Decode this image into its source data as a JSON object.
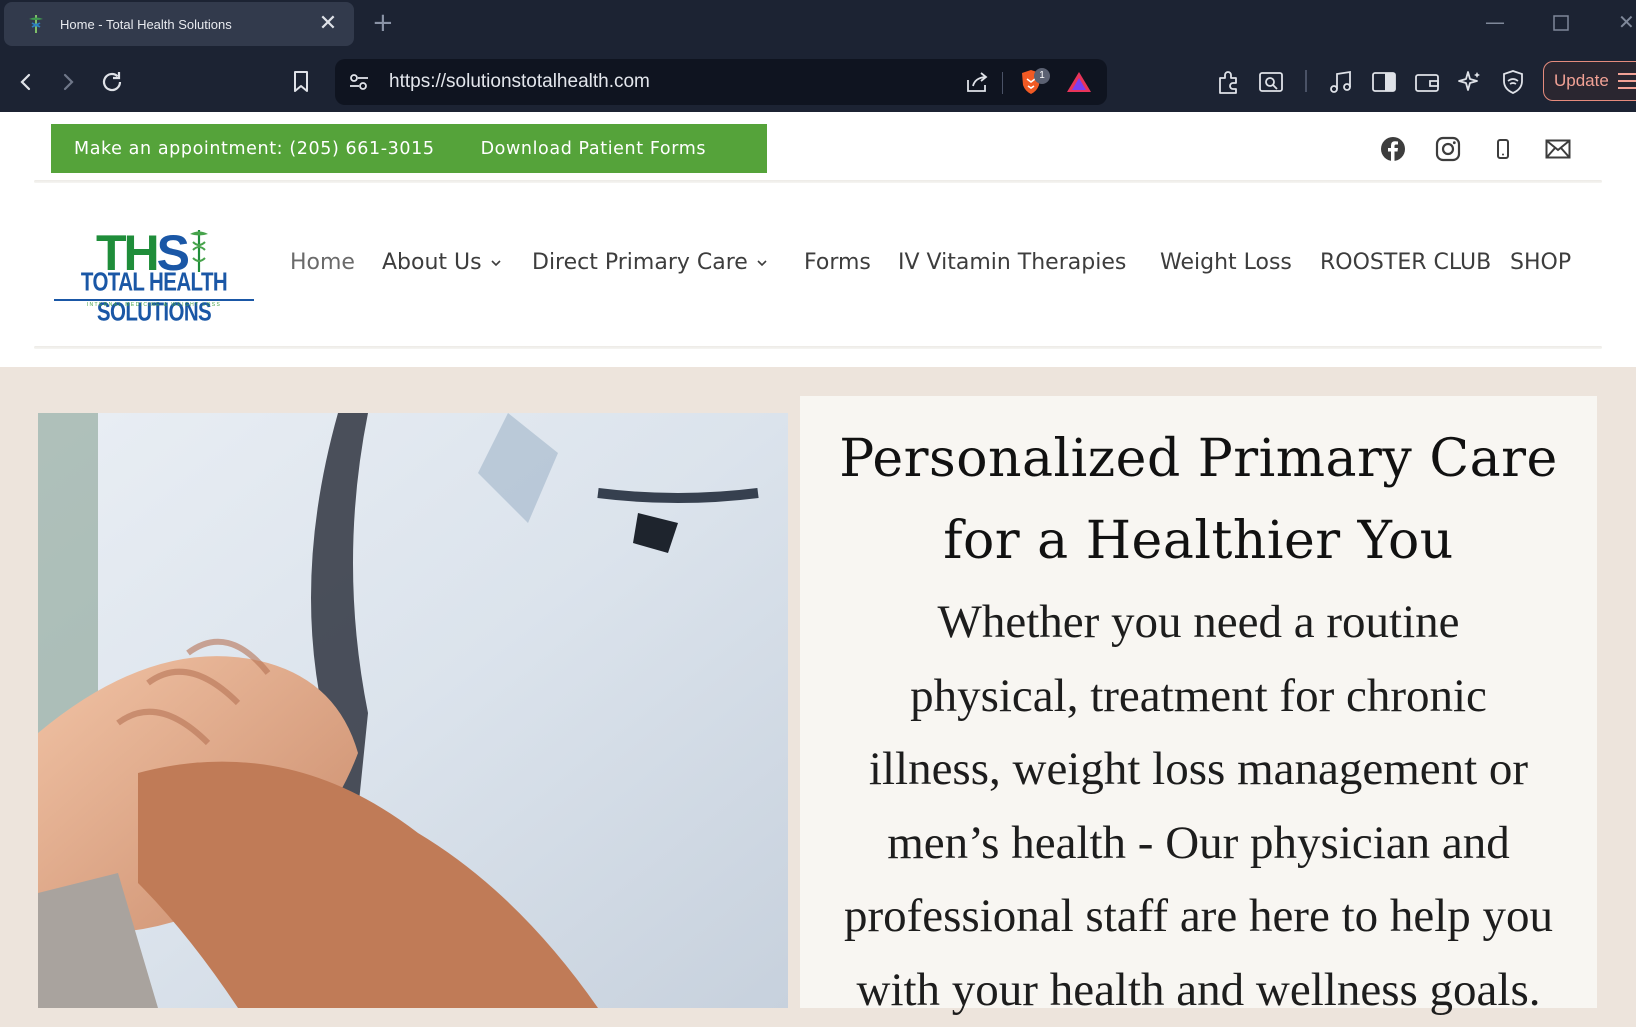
{
  "browser": {
    "tab_title": "Home - Total Health Solutions",
    "url": "https://solutionstotalhealth.com",
    "shields_count": "1",
    "update_label": "Update"
  },
  "topbar": {
    "appointment": "Make an appointment: (205) 661-3015",
    "forms": "Download Patient Forms"
  },
  "logo": {
    "mark_t": "T",
    "mark_h": "H",
    "mark_s": "S",
    "name": "TOTAL HEALTH SOLUTIONS",
    "tagline": "INTERNAL MEDICINE & WEIGHT LOSS"
  },
  "nav": {
    "items": [
      {
        "label": "Home"
      },
      {
        "label": "About Us"
      },
      {
        "label": "Direct Primary Care"
      },
      {
        "label": "Forms"
      },
      {
        "label": "IV Vitamin Therapies"
      },
      {
        "label": "Weight Loss"
      },
      {
        "label": "ROOSTER CLUB"
      },
      {
        "label": "SHOP"
      }
    ]
  },
  "hero": {
    "title_line1": "Personalized Primary Care",
    "title_line2": "for a Healthier You",
    "body_lines": [
      "Whether you need a routine",
      "physical, treatment for chronic",
      "illness, weight loss management or",
      "men’s health - Our physician and",
      "professional staff are here to help you",
      "with your health and wellness goals."
    ]
  },
  "colors": {
    "accent_green": "#55a33a",
    "logo_blue": "#1a57a6",
    "page_beige": "#ede4dc",
    "chrome_dark": "#1c2333"
  }
}
